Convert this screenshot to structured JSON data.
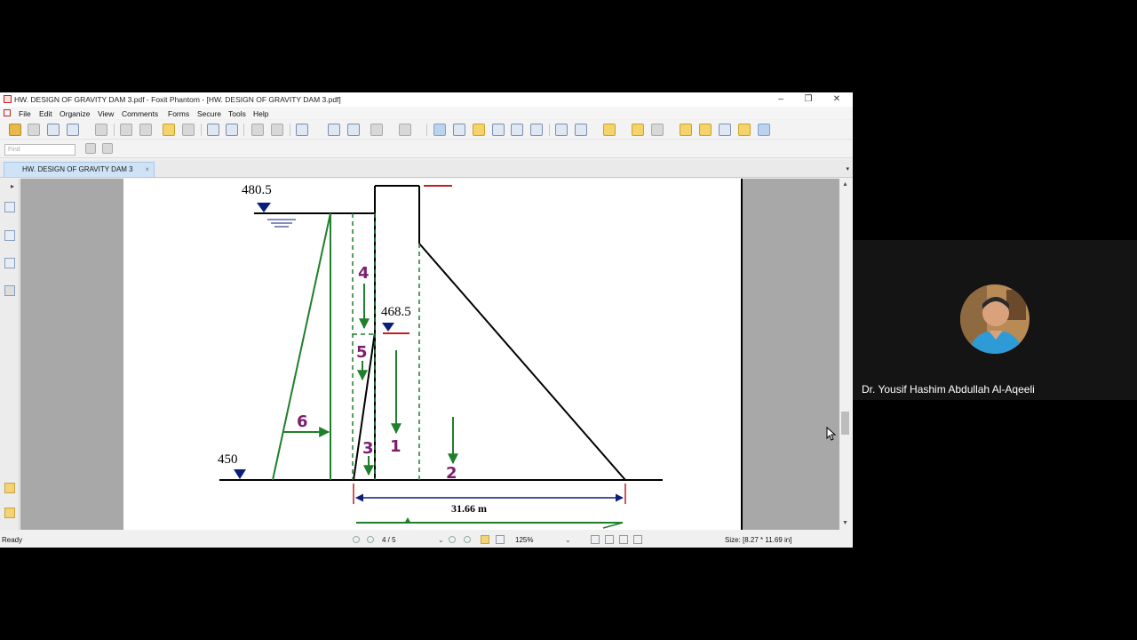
{
  "window": {
    "title": "HW. DESIGN OF GRAVITY DAM 3.pdf - Foxit Phantom - [HW. DESIGN OF GRAVITY DAM 3.pdf]",
    "minimize": "–",
    "maximize": "❐",
    "close": "✕"
  },
  "menu": [
    "File",
    "Edit",
    "Organize",
    "View",
    "Comments",
    "Forms",
    "Secure",
    "Tools",
    "Help"
  ],
  "find": {
    "placeholder": "Find"
  },
  "tab": {
    "label": "HW. DESIGN OF GRAVITY DAM 3",
    "close": "×"
  },
  "drawing": {
    "elev_top": "480.5",
    "elev_mid": "468.5",
    "elev_bottom": "450",
    "base_width": "31.66 m",
    "forces": [
      "1",
      "2",
      "3",
      "4",
      "5",
      "6"
    ]
  },
  "status": {
    "ready": "Ready",
    "page": "4 / 5",
    "zoom": "125%",
    "size": "Size: [8.27 * 11.69 in]"
  },
  "participant": {
    "name": "Dr. Yousif Hashim Abdullah Al-Aqeeli"
  },
  "colors": {
    "force_green": "#1f7f2a",
    "label_purple": "#7a1f6e",
    "marker_navy": "#0b1f7a",
    "level_red": "#c02020"
  }
}
